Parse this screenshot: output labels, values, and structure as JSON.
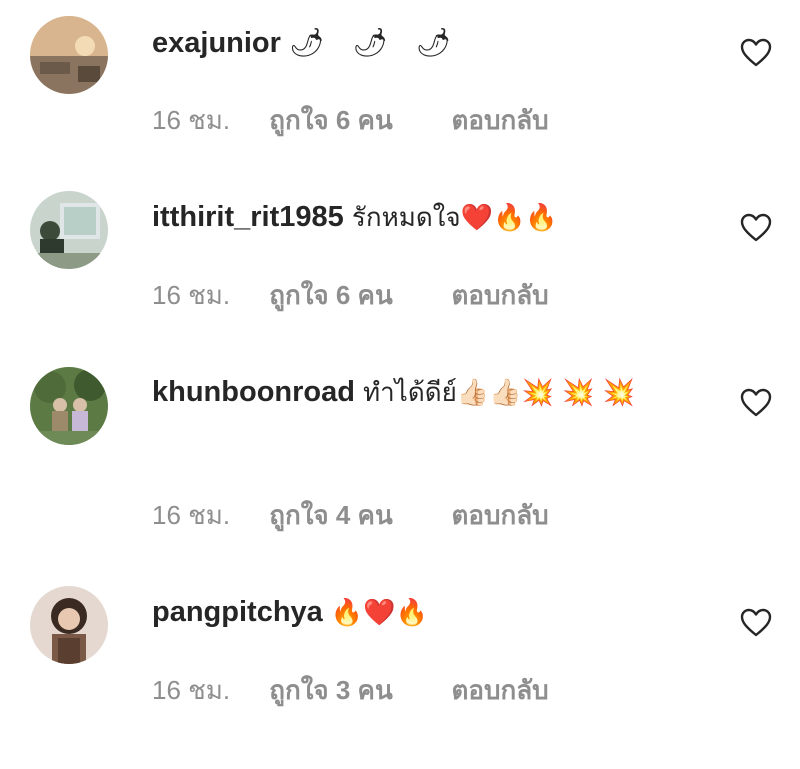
{
  "comments": [
    {
      "username": "exajunior",
      "text": "🌶 🌶 🌶",
      "time": "16 ชม.",
      "likes": "ถูกใจ 6 คน",
      "reply": "ตอบกลับ",
      "avatar_colors": [
        "#c9a27a",
        "#e8c8a0",
        "#6b5a4a"
      ]
    },
    {
      "username": "itthirit_rit1985",
      "text": "รักหมดใจ❤️🔥🔥",
      "time": "16 ชม.",
      "likes": "ถูกใจ 6 คน",
      "reply": "ตอบกลับ",
      "avatar_colors": [
        "#b8cfc8",
        "#3c4a3a",
        "#e0e6e8"
      ]
    },
    {
      "username": "khunboonroad",
      "text": "ทำได้ดีย์👍🏻👍🏻💥 💥 💥",
      "time": "16 ชม.",
      "likes": "ถูกใจ 4 คน",
      "reply": "ตอบกลับ",
      "avatar_colors": [
        "#4f6b3a",
        "#9c8a6a",
        "#c8b8d8"
      ]
    },
    {
      "username": "pangpitchya",
      "text": "🔥❤️🔥",
      "time": "16 ชม.",
      "likes": "ถูกใจ 3 คน",
      "reply": "ตอบกลับ",
      "avatar_colors": [
        "#e4d8d0",
        "#7a5a46",
        "#3a2a22"
      ]
    }
  ],
  "icons": {
    "like": "heart-outline-icon",
    "chili": "chili-pepper-icon"
  },
  "colors": {
    "text": "#262626",
    "meta": "#8e8e8e",
    "heart_stroke": "#262626"
  }
}
